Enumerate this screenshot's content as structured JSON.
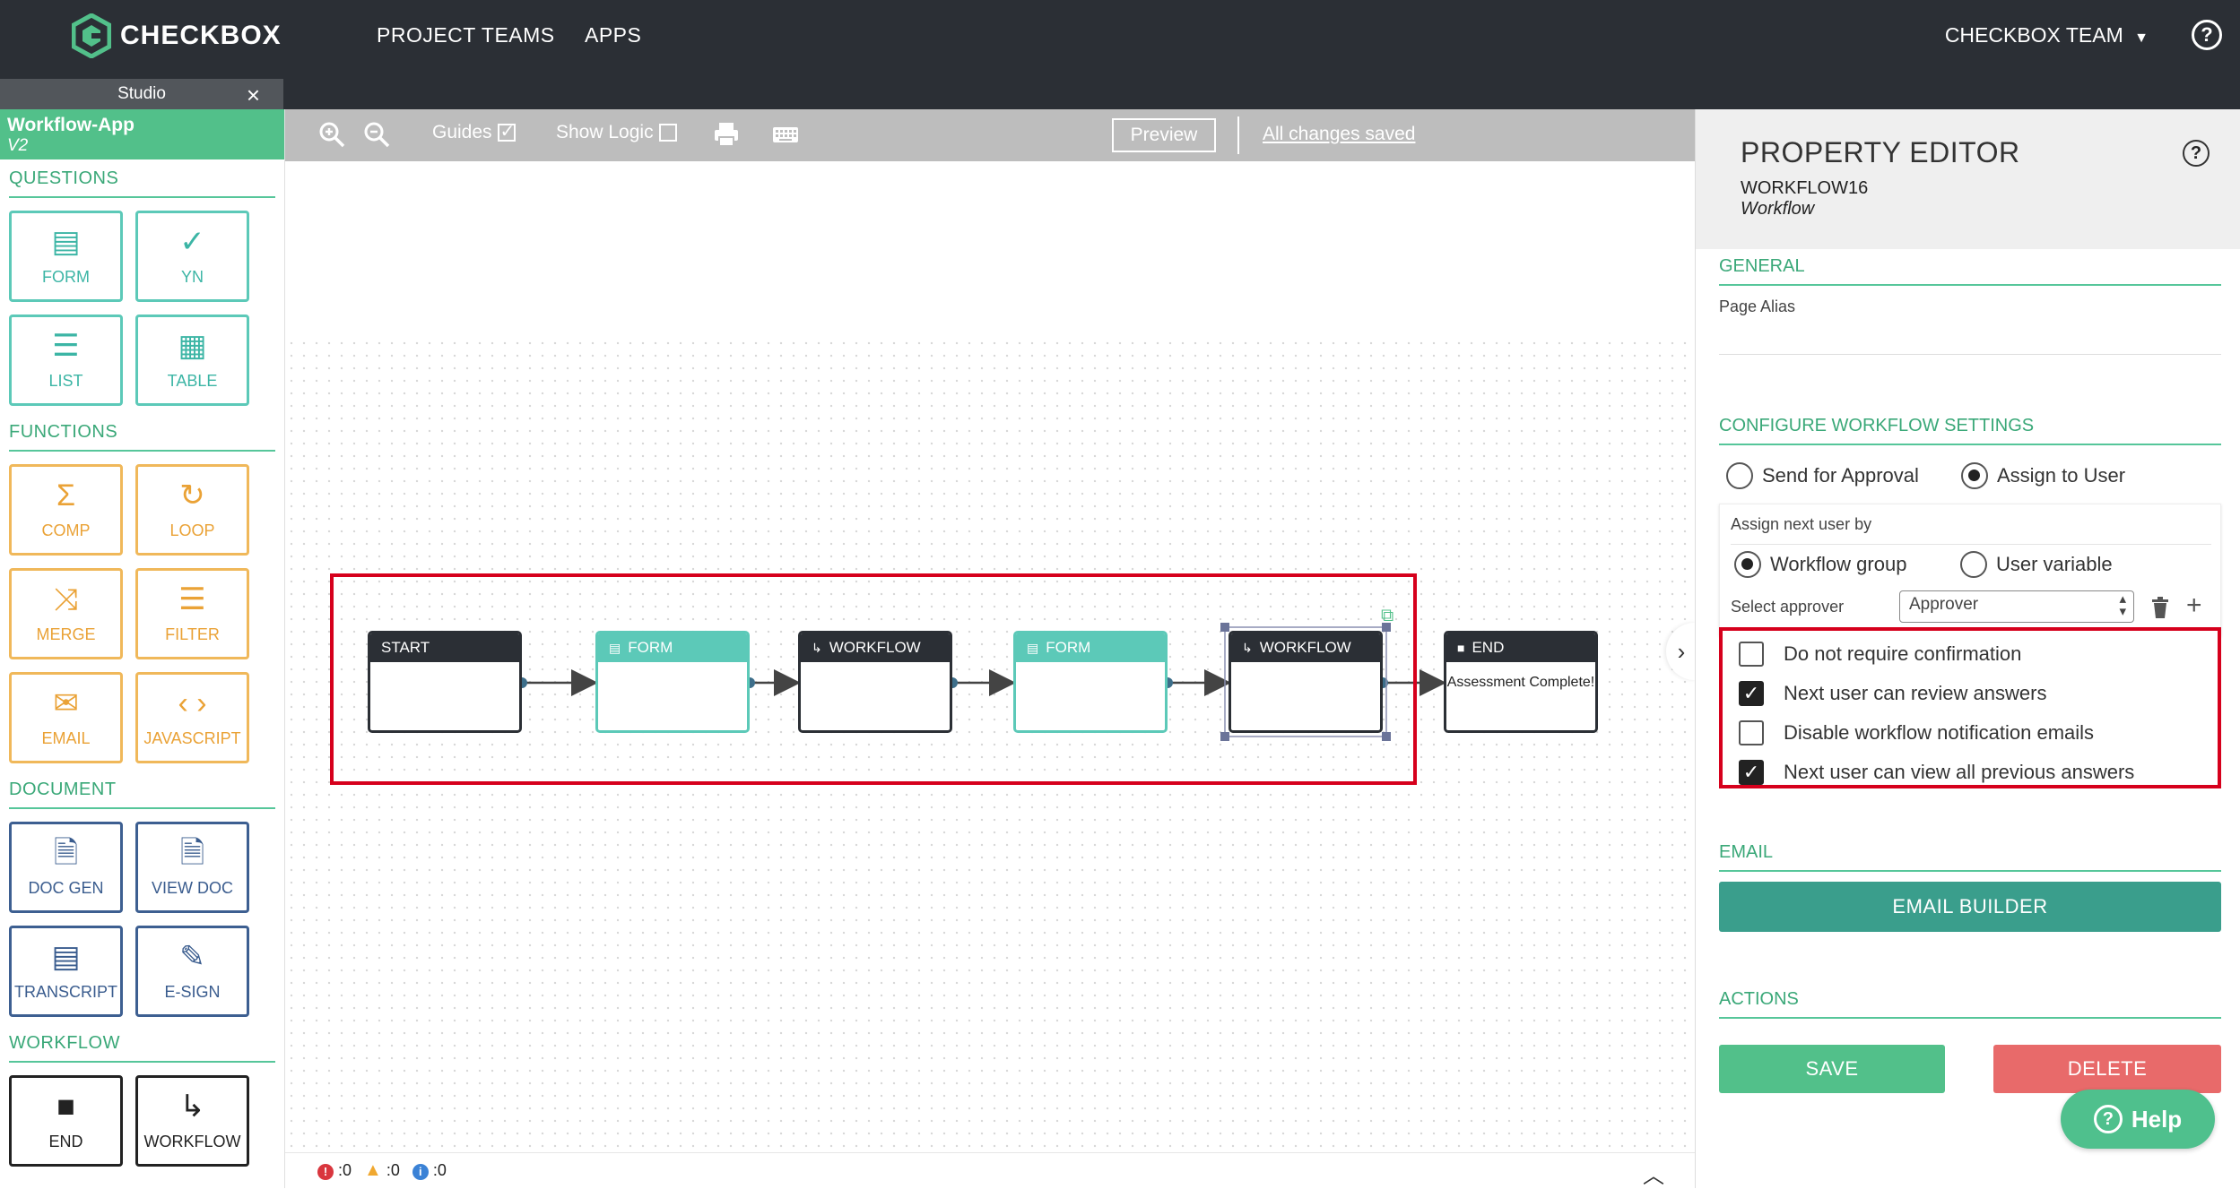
{
  "topbar": {
    "brand": "CHECKBOX",
    "nav": [
      "PROJECT TEAMS",
      "APPS"
    ],
    "team": "CHECKBOX TEAM",
    "help_glyph": "?"
  },
  "studio_tab": {
    "label": "Studio",
    "close": "×"
  },
  "app": {
    "name": "Workflow-App",
    "version": "V2"
  },
  "sidebar": {
    "questions": {
      "title": "QUESTIONS",
      "items": [
        {
          "label": "FORM",
          "icon": "form-icon",
          "glyph": "▤"
        },
        {
          "label": "YN",
          "icon": "check-icon",
          "glyph": "✓"
        },
        {
          "label": "LIST",
          "icon": "list-icon",
          "glyph": "☰"
        },
        {
          "label": "TABLE",
          "icon": "table-icon",
          "glyph": "▦"
        }
      ]
    },
    "functions": {
      "title": "FUNCTIONS",
      "items": [
        {
          "label": "COMP",
          "icon": "sigma-icon",
          "glyph": "Σ"
        },
        {
          "label": "LOOP",
          "icon": "loop-icon",
          "glyph": "↻"
        },
        {
          "label": "MERGE",
          "icon": "merge-icon",
          "glyph": "⤨"
        },
        {
          "label": "FILTER",
          "icon": "filter-icon",
          "glyph": "☰"
        },
        {
          "label": "EMAIL",
          "icon": "envelope-icon",
          "glyph": "✉"
        },
        {
          "label": "JAVASCRIPT",
          "icon": "code-icon",
          "glyph": "‹ ›"
        }
      ]
    },
    "document": {
      "title": "DOCUMENT",
      "items": [
        {
          "label": "DOC GEN",
          "icon": "doc-add-icon",
          "glyph": "🗎"
        },
        {
          "label": "VIEW DOC",
          "icon": "doc-icon",
          "glyph": "🗎"
        },
        {
          "label": "TRANSCRIPT",
          "icon": "transcript-icon",
          "glyph": "▤"
        },
        {
          "label": "E-SIGN",
          "icon": "pencil-icon",
          "glyph": "✎"
        }
      ]
    },
    "workflow": {
      "title": "WORKFLOW",
      "items": [
        {
          "label": "END",
          "icon": "stop-icon",
          "glyph": "■"
        },
        {
          "label": "WORKFLOW",
          "icon": "branch-arrow-icon",
          "glyph": "↳"
        }
      ]
    }
  },
  "toolbar": {
    "guides_label": "Guides",
    "guides_checked": true,
    "show_logic_label": "Show Logic",
    "show_logic_checked": false,
    "preview_label": "Preview",
    "saved_label": "All changes saved"
  },
  "flow": {
    "nodes": [
      {
        "id": "start",
        "kind": "start",
        "title": "START",
        "body": ""
      },
      {
        "id": "form1",
        "kind": "form",
        "title": "FORM",
        "body": ""
      },
      {
        "id": "wf1",
        "kind": "workflow",
        "title": "WORKFLOW",
        "body": ""
      },
      {
        "id": "form2",
        "kind": "form",
        "title": "FORM",
        "body": ""
      },
      {
        "id": "wf2",
        "kind": "workflow",
        "title": "WORKFLOW",
        "body": "",
        "selected": true
      },
      {
        "id": "end",
        "kind": "end",
        "title": "END",
        "body": "Assessment Complete!"
      }
    ]
  },
  "status": {
    "errors": ":0",
    "warnings": ":0",
    "info": ":0"
  },
  "property_editor": {
    "title": "PROPERTY EDITOR",
    "item_id": "WORKFLOW16",
    "item_type": "Workflow",
    "general": {
      "title": "GENERAL",
      "page_alias_label": "Page Alias",
      "page_alias_value": ""
    },
    "workflow_settings": {
      "title": "CONFIGURE WORKFLOW SETTINGS",
      "mode_options": [
        {
          "label": "Send for Approval",
          "selected": false
        },
        {
          "label": "Assign to User",
          "selected": true
        }
      ],
      "assign_label": "Assign next user by",
      "assign_options": [
        {
          "label": "Workflow group",
          "selected": true
        },
        {
          "label": "User variable",
          "selected": false
        }
      ],
      "approver_label": "Select approver",
      "approver_value": "Approver",
      "options": [
        {
          "label": "Do not require confirmation",
          "checked": false
        },
        {
          "label": "Next user can review answers",
          "checked": true
        },
        {
          "label": "Disable workflow notification emails",
          "checked": false
        },
        {
          "label": "Next user can view all previous answers",
          "checked": true
        }
      ]
    },
    "email": {
      "title": "EMAIL",
      "builder_label": "EMAIL BUILDER"
    },
    "actions": {
      "title": "ACTIONS",
      "save_label": "SAVE",
      "delete_label": "DELETE"
    }
  },
  "help_button": {
    "label": "Help"
  },
  "colors": {
    "topbar": "#2b2f35",
    "brand_green": "#52c08a",
    "teal": "#5cc9b8",
    "orange": "#eaa236",
    "navy": "#3a5c8e",
    "email_builder": "#3a9e8c",
    "save": "#52c08a",
    "delete": "#e86a6a",
    "highlight_red": "#d6001c"
  }
}
